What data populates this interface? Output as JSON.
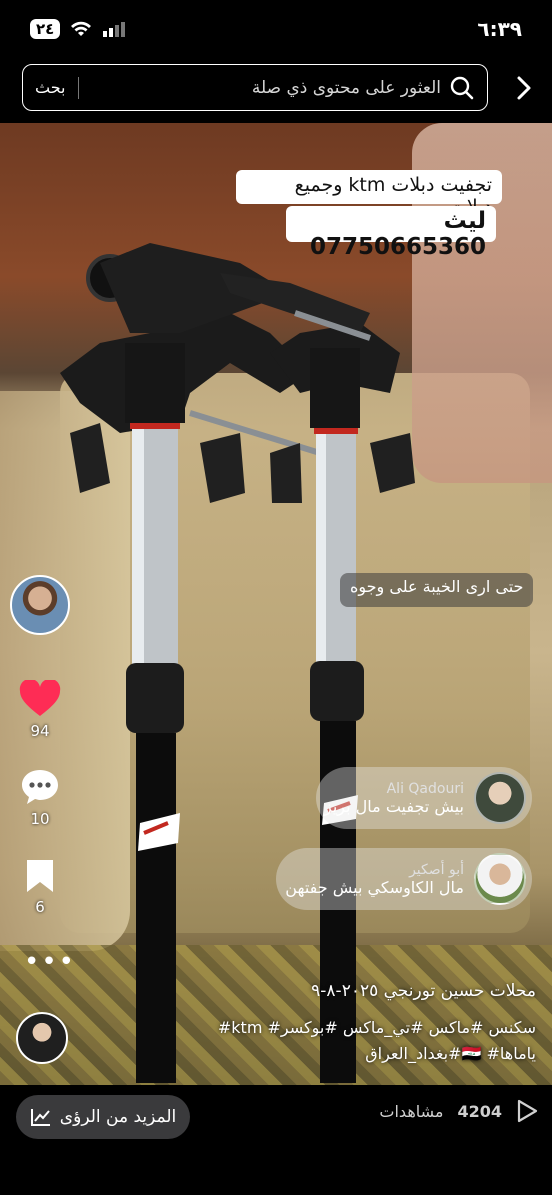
{
  "status_bar": {
    "time": "٦:٣٩",
    "battery": "٢٤"
  },
  "search": {
    "placeholder": "العثور على محتوى ذي صلة",
    "button": "بحث"
  },
  "video_overlay": {
    "caption_line1": "تجفيت دبلات ktm وجميع دبلات",
    "caption_line2": "ليث 07750665360",
    "floating_comment": "حتى ارى الخيبة على وجوه"
  },
  "comments": [
    {
      "author": "Ali Qadouri",
      "text": "بيش تجفيت مال بريز"
    },
    {
      "author": "أبو أصكير",
      "text": "مال الكاوسكي بيش جفتهن"
    }
  ],
  "actions": {
    "likes": "94",
    "comments": "10",
    "saves": "6"
  },
  "post": {
    "author_line": "محلات حسين تورنجي ٢٠٢٥-٨-٩",
    "tags_line1": "سكنس #ماكس #تي_ماكس #بوكسر# ktm#",
    "tags_line2": "ياماها# 🇮🇶#بغداد_العراق"
  },
  "bottom": {
    "insights_label": "المزيد من الرؤى",
    "views_count": "4204",
    "views_label": "مشاهدات"
  },
  "colors": {
    "like": "#fe2c55",
    "background": "#000000",
    "caption_bg": "#ffffff"
  }
}
